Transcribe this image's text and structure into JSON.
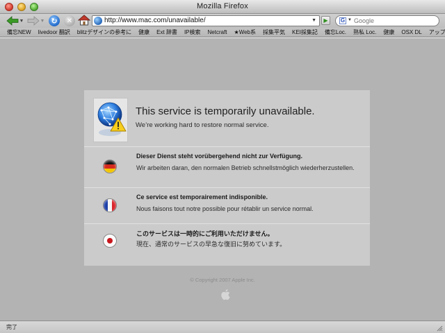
{
  "window": {
    "title": "Mozilla Firefox"
  },
  "toolbar": {
    "url": "http://www.mac.com/unavailable/",
    "search_placeholder": "Google"
  },
  "bookmarks": [
    "備忘NEW",
    "livedoor 翻訳",
    "blitzデザインの参考に",
    "健康",
    "Ext 辞書",
    "IP検索",
    "Netcraft",
    "★Web系",
    "採集平気",
    "KEI採集記",
    "備忘Loc.",
    "熟私 Loc.",
    "健康",
    "OSX DL",
    "アップル"
  ],
  "notice": {
    "title": "This service is temporarily unavailable.",
    "subtitle": "We’re working hard to restore normal service.",
    "languages": [
      {
        "flag": "germany",
        "title": "Dieser Dienst steht vorübergehend nicht zur Verfügung.",
        "body": "Wir arbeiten daran, den normalen Betrieb schnellstmöglich wiederherzustellen."
      },
      {
        "flag": "france",
        "title": "Ce service est temporairement indisponible.",
        "body": "Nous faisons tout notre possible pour rétablir un service normal."
      },
      {
        "flag": "japan",
        "title": "このサービスは一時的にご利用いただけません。",
        "body": "現在、通常のサービスの早急な復旧に努めています。"
      }
    ]
  },
  "footer": {
    "copyright": "© Copyright 2007 Apple Inc."
  },
  "status": {
    "text": "完了"
  },
  "colors": {
    "page_background": "#b3b3b3",
    "panel_background": "#cbcbcb",
    "accent_blue": "#1a63c6"
  }
}
